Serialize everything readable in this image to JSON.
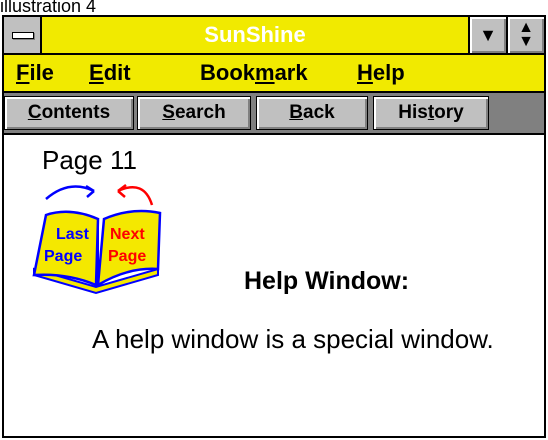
{
  "caption": "illustration 4",
  "window": {
    "title": "SunShine"
  },
  "menu": [
    {
      "accel": "F",
      "rest": "ile"
    },
    {
      "accel": "E",
      "rest": "dit"
    },
    {
      "pre": "Book",
      "accel": "m",
      "rest": "ark"
    },
    {
      "accel": "H",
      "rest": "elp"
    }
  ],
  "toolbar": [
    {
      "accel": "C",
      "rest": "ontents"
    },
    {
      "accel": "S",
      "rest": "earch"
    },
    {
      "accel": "B",
      "rest": "ack"
    },
    {
      "pre": "His",
      "accel": "t",
      "rest": "ory"
    }
  ],
  "content": {
    "page_number": "Page 11",
    "book_left": [
      "Last",
      "Page"
    ],
    "book_right": [
      "Next",
      "Page"
    ],
    "heading": "Help Window:",
    "body": "A help window is a special window."
  },
  "colors": {
    "titlebar": "#f1ea00",
    "menubar": "#f1ea00",
    "toolbar_bg": "#808080",
    "button_face": "#c0c0c0",
    "book_page": "#f4e800",
    "book_outline": "#0000ff",
    "left_arrow": "#0000ff",
    "right_arrow": "#ff0000"
  }
}
